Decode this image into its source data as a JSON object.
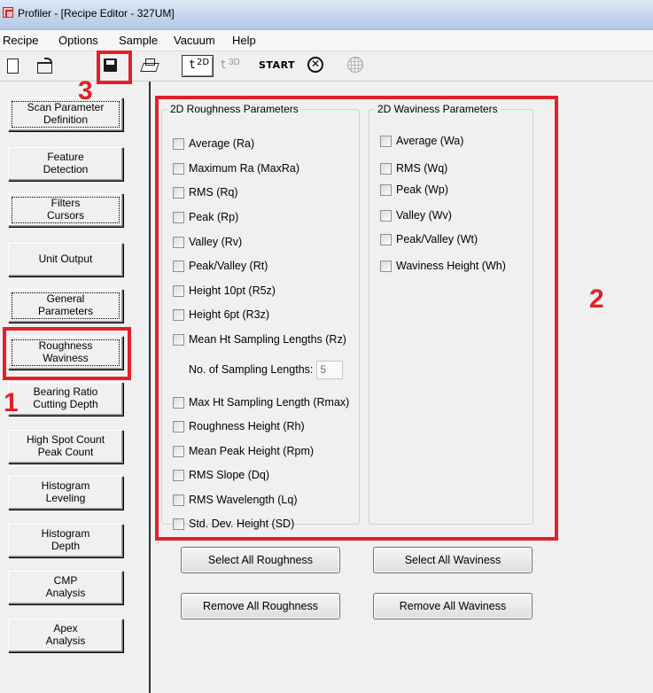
{
  "window": {
    "title": "Profiler - [Recipe Editor - 327UM]"
  },
  "menu": [
    "Recipe",
    "Options",
    "Sample",
    "Vacuum",
    "Help"
  ],
  "toolbar": {
    "icons": [
      "new-file-icon",
      "open-folder-icon",
      "save-disk-icon",
      "print-icon",
      "2d-scan-icon",
      "3d-scan-icon",
      "stop-icon",
      "globe-icon"
    ],
    "label_2d": "2D",
    "label_3d": "3D",
    "start_label": "START"
  },
  "sidebar": {
    "items": [
      {
        "label": "Scan Parameter\nDefinition"
      },
      {
        "label": "Feature\nDetection"
      },
      {
        "label": "Filters\nCursors"
      },
      {
        "label": "Unit Output"
      },
      {
        "label": "General\nParameters"
      },
      {
        "label": "Roughness\nWaviness"
      },
      {
        "label": "Bearing Ratio\nCutting Depth"
      },
      {
        "label": "High Spot Count\nPeak Count"
      },
      {
        "label": "Histogram\nLeveling"
      },
      {
        "label": "Histogram\nDepth"
      },
      {
        "label": "CMP\nAnalysis"
      },
      {
        "label": "Apex\nAnalysis"
      }
    ]
  },
  "roughness": {
    "title": "2D Roughness Parameters",
    "items": [
      "Average (Ra)",
      "Maximum Ra (MaxRa)",
      "RMS (Rq)",
      "Peak (Rp)",
      "Valley (Rv)",
      "Peak/Valley (Rt)",
      "Height 10pt (R5z)",
      "Height 6pt (R3z)",
      "Mean Ht Sampling Lengths (Rz)",
      "Max Ht Sampling Length (Rmax)",
      "Roughness Height (Rh)",
      "Mean Peak Height (Rpm)",
      "RMS Slope (Dq)",
      "RMS Wavelength (Lq)",
      "Std. Dev. Height (SD)"
    ],
    "sampling_label": "No. of Sampling Lengths:",
    "sampling_value": "5"
  },
  "waviness": {
    "title": "2D Waviness Parameters",
    "items": [
      "Average (Wa)",
      "RMS (Wq)",
      "Peak (Wp)",
      "Valley (Wv)",
      "Peak/Valley (Wt)",
      "Waviness Height (Wh)"
    ]
  },
  "buttons": {
    "select_roughness": "Select All Roughness",
    "select_waviness": "Select All Waviness",
    "remove_roughness": "Remove All Roughness",
    "remove_waviness": "Remove All Waviness"
  },
  "annotations": {
    "one": "1",
    "two": "2",
    "three": "3",
    "color": "#e0212b"
  }
}
